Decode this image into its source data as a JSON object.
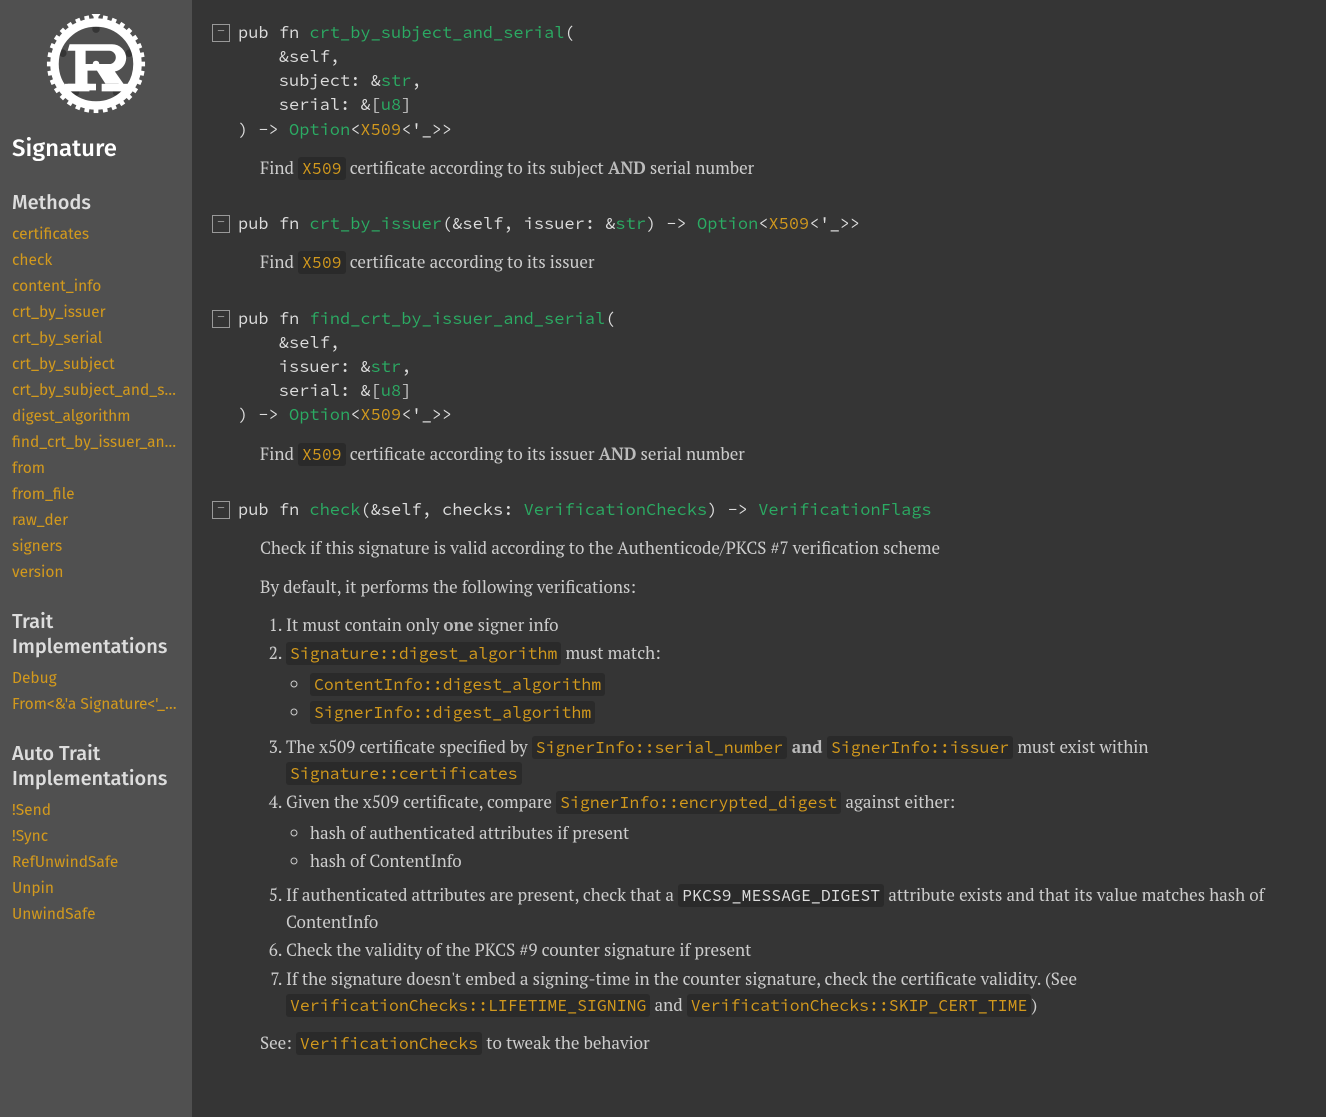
{
  "sidebar": {
    "title": "Signature",
    "sections": {
      "methods": {
        "heading": "Methods",
        "links": [
          "certificates",
          "check",
          "content_info",
          "crt_by_issuer",
          "crt_by_serial",
          "crt_by_subject",
          "crt_by_subject_and_serial",
          "digest_algorithm",
          "find_crt_by_issuer_and_serial",
          "from",
          "from_file",
          "raw_der",
          "signers",
          "version"
        ]
      },
      "trait_impl": {
        "heading": "Trait Implementations",
        "links": [
          "Debug",
          "From<&'a Signature<'_>>"
        ]
      },
      "auto_trait_impl": {
        "heading": "Auto Trait Implementations",
        "links": [
          "!Send",
          "!Sync",
          "RefUnwindSafe",
          "Unpin",
          "UnwindSafe"
        ]
      }
    }
  },
  "toggles": {
    "collapse": "−"
  },
  "methods": {
    "m0": {
      "sig_open": "pub fn ",
      "name": "crt_by_subject_and_serial",
      "sig_after_name": "(",
      "l2": "    &self,",
      "l3a": "    subject: &",
      "l3b": "str",
      "l3c": ",",
      "l4a": "    serial: &[",
      "l4b": "u8",
      "l4c": "]",
      "l5a": ") -> ",
      "l5b": "Option",
      "l5c": "<",
      "l5d": "X509",
      "l5e": "<'_>>",
      "doc_pre": "Find ",
      "doc_code": "X509",
      "doc_mid": " certificate according to its subject ",
      "doc_bold": "AND",
      "doc_post": " serial number"
    },
    "m1": {
      "sig_open": "pub fn ",
      "name": "crt_by_issuer",
      "after_a": "(&self, issuer: &",
      "prim": "str",
      "after_b": ") -> ",
      "opt": "Option",
      "after_c": "<",
      "x509": "X509",
      "after_d": "<'_>>",
      "doc_pre": "Find ",
      "doc_code": "X509",
      "doc_post": " certificate according to its issuer"
    },
    "m2": {
      "sig_open": "pub fn ",
      "name": "find_crt_by_issuer_and_serial",
      "sig_after_name": "(",
      "l2": "    &self,",
      "l3a": "    issuer: &",
      "l3b": "str",
      "l3c": ",",
      "l4a": "    serial: &[",
      "l4b": "u8",
      "l4c": "]",
      "l5a": ") -> ",
      "l5b": "Option",
      "l5c": "<",
      "l5d": "X509",
      "l5e": "<'_>>",
      "doc_pre": "Find ",
      "doc_code": "X509",
      "doc_mid": " certificate according to its issuer ",
      "doc_bold": "AND",
      "doc_post": " serial number"
    },
    "m3": {
      "sig_open": "pub fn ",
      "name": "check",
      "after_a": "(&self, checks: ",
      "vc": "VerificationChecks",
      "after_b": ") -> ",
      "vf": "VerificationFlags",
      "p1": "Check if this signature is valid according to the Authenticode/PKCS #7 verification scheme",
      "p2": "By default, it performs the following verifications:",
      "li1_a": "It must contain only ",
      "li1_b": "one",
      "li1_c": " signer info",
      "li2_a": "",
      "li2_code": "Signature::digest_algorithm",
      "li2_b": " must match:",
      "li2_s1": "ContentInfo::digest_algorithm",
      "li2_s2": "SignerInfo::digest_algorithm",
      "li3_a": "The x509 certificate specified by ",
      "li3_c1": "SignerInfo::serial_number",
      "li3_b": " and ",
      "li3_c2": "SignerInfo::issuer",
      "li3_c": " must exist within ",
      "li3_c3": "Signature::certificates",
      "li4_a": "Given the x509 certificate, compare ",
      "li4_c": "SignerInfo::encrypted_digest",
      "li4_b": " against either:",
      "li4_s1": "hash of authenticated attributes if present",
      "li4_s2": "hash of ContentInfo",
      "li5_a": "If authenticated attributes are present, check that a ",
      "li5_c": "PKCS9_MESSAGE_DIGEST",
      "li5_b": " attribute exists and that its value matches hash of ContentInfo",
      "li6": "Check the validity of the PKCS #9 counter signature if present",
      "li7_a": "If the signature doesn't embed a signing-time in the counter signature, check the certificate validity. (See ",
      "li7_c1": "VerificationChecks::LIFETIME_SIGNING",
      "li7_b": " and ",
      "li7_c2": "VerificationChecks::SKIP_CERT_TIME",
      "li7_c": ")",
      "p3_a": "See: ",
      "p3_c": "VerificationChecks",
      "p3_b": " to tweak the behavior"
    }
  }
}
